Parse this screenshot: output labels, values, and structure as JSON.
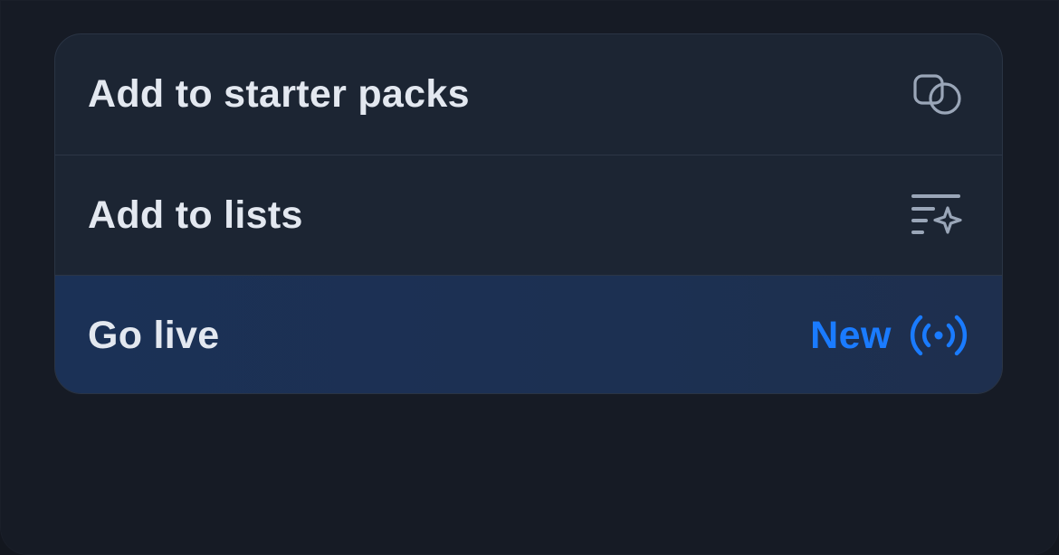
{
  "menu": {
    "items": [
      {
        "label": "Add to starter packs",
        "icon": "starter-pack-icon"
      },
      {
        "label": "Add to lists",
        "icon": "list-sparkle-icon"
      },
      {
        "label": "Go live",
        "badge": "New",
        "icon": "broadcast-icon"
      }
    ]
  },
  "colors": {
    "background": "#161b25",
    "menu_bg": "#1c2533",
    "highlight_bg": "#1c3052",
    "text": "#e3e8f0",
    "icon": "#9aa6b8",
    "accent": "#1a7bff"
  }
}
